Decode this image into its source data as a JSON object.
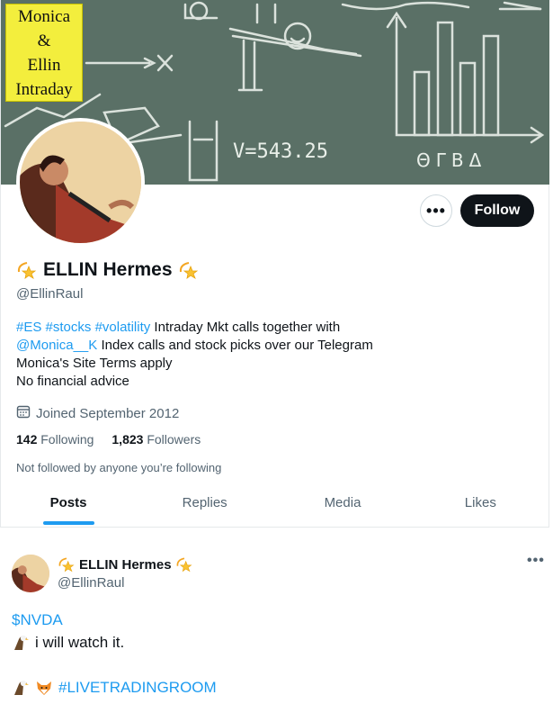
{
  "banner": {
    "label_lines": [
      "Monica",
      "&",
      "Ellin",
      "Intraday"
    ],
    "chalk_text": "V=543.25",
    "chalk_letters": "ΘΓΒΔ"
  },
  "profile": {
    "display_name": "ELLIN Hermes",
    "handle": "@EllinRaul",
    "follow_label": "Follow",
    "more_label": "•••",
    "bio": {
      "tag1": "#ES",
      "tag2": "#stocks",
      "tag3": "#volatility",
      "text1": " Intraday Mkt calls together with",
      "mention": "@Monica__K",
      "text2": " Index calls and stock picks over our Telegram",
      "line3": "Monica's Site Terms apply",
      "line4": "No financial advice"
    },
    "joined": "Joined September 2012",
    "following_count": "142",
    "following_label": "Following",
    "followers_count": "1,823",
    "followers_label": "Followers",
    "not_followed": "Not followed by anyone you’re following"
  },
  "tabs": [
    {
      "label": "Posts",
      "active": true
    },
    {
      "label": "Replies",
      "active": false
    },
    {
      "label": "Media",
      "active": false
    },
    {
      "label": "Likes",
      "active": false
    }
  ],
  "post": {
    "display_name": "ELLIN Hermes",
    "handle": "@EllinRaul",
    "more_label": "•••",
    "cashtag": "$NVDA",
    "line2": "i will watch it.",
    "hashtag": "#LIVETRADINGROOM"
  },
  "colors": {
    "accent": "#1d9bf0",
    "banner_bg": "#5a7066",
    "label_bg": "#f3ee3d"
  },
  "icons": {
    "name_star": "dizzy-star-icon",
    "calendar": "calendar-icon",
    "eagle": "eagle-icon",
    "fox": "fox-icon"
  }
}
